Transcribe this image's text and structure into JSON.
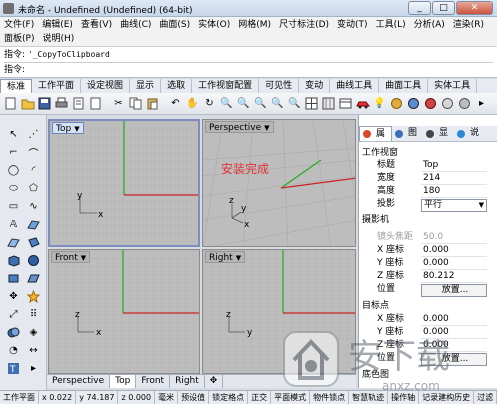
{
  "window": {
    "title": "未命名 - Undefined (Undefined) (64-bit)",
    "controls": [
      "_",
      "□",
      "✕"
    ]
  },
  "menu": {
    "row1": [
      "文件(F)",
      "编辑(E)",
      "查看(V)",
      "曲线(C)",
      "曲面(S)",
      "实体(O)",
      "网格(M)",
      "尺寸标注(D)",
      "变动(T)",
      "工具(L)",
      "分析(A)",
      "渲染(R)"
    ],
    "row2": [
      "面板(P)",
      "说明(H)"
    ]
  },
  "command": {
    "history_label": "指令:",
    "history_text": "'_CopyToClipboard",
    "prompt_label": "指令:",
    "prompt_value": ""
  },
  "toolbar_tabs": [
    "标准",
    "工作平面",
    "设定视图",
    "显示",
    "选取",
    "工作视窗配置",
    "可见性",
    "变动",
    "曲线工具",
    "曲面工具",
    "实体工具"
  ],
  "active_toolbar_tab": "标准",
  "viewports": {
    "top": {
      "name": "Top",
      "arrow": "▼"
    },
    "perspective": {
      "name": "Perspective",
      "arrow": "▼",
      "overlay_text": "安装完成"
    },
    "front": {
      "name": "Front",
      "arrow": "▼"
    },
    "right": {
      "name": "Right",
      "arrow": "▼"
    },
    "axis_x": "x",
    "axis_y": "y",
    "axis_z": "z"
  },
  "viewport_tabs": [
    "Perspective",
    "Top",
    "Front",
    "Right"
  ],
  "active_viewport_tab": "Top",
  "viewport_tab_add": "✥",
  "panel": {
    "tabs": [
      {
        "label": "属",
        "icon": "properties-icon",
        "color": "#d64a2a"
      },
      {
        "label": "图",
        "icon": "layers-icon",
        "color": "#3c6fb8"
      },
      {
        "label": "显",
        "icon": "display-icon",
        "color": "#444444"
      },
      {
        "label": "说",
        "icon": "help-icon",
        "color": "#2a8ad6"
      }
    ],
    "viewport_section": "工作视窗",
    "rows": [
      {
        "label": "标题",
        "value": "Top"
      },
      {
        "label": "宽度",
        "value": "214"
      },
      {
        "label": "高度",
        "value": "180"
      },
      {
        "label": "投影",
        "value": "平行"
      }
    ],
    "camera_section": "摄影机",
    "lens_label": "镜头焦距",
    "lens_value": "50.0",
    "camera_rows": [
      {
        "label": "X 座标",
        "value": "0.000"
      },
      {
        "label": "Y 座标",
        "value": "0.000"
      },
      {
        "label": "Z 座标",
        "value": "80.212"
      }
    ],
    "position_label": "位置",
    "position_button": "放置...",
    "target_section": "目标点",
    "target_rows": [
      {
        "label": "X 座标",
        "value": "0.000"
      },
      {
        "label": "Y 座标",
        "value": "0.000"
      },
      {
        "label": "Z 座标",
        "value": "0.000"
      }
    ],
    "target_position_label": "位置",
    "target_position_button": "放置...",
    "bottom_section": "底色图"
  },
  "status": {
    "items": [
      "工作平面",
      "x 0.022",
      "y 74.187",
      "z 0.000",
      "毫米",
      "预设值",
      "锁定格点",
      "正交",
      "平面模式",
      "物件锁点",
      "智慧轨迹",
      "操作轴",
      "记录建构历史",
      "过滤"
    ]
  },
  "watermark": {
    "text": "安下载",
    "url": "anxz.com"
  },
  "colors": {
    "x_axis": "#cc2222",
    "y_axis": "#22aa22",
    "grid_bg": "#bdbdbd",
    "grid_line": "#ababab",
    "overlay_text": "#e33333"
  }
}
